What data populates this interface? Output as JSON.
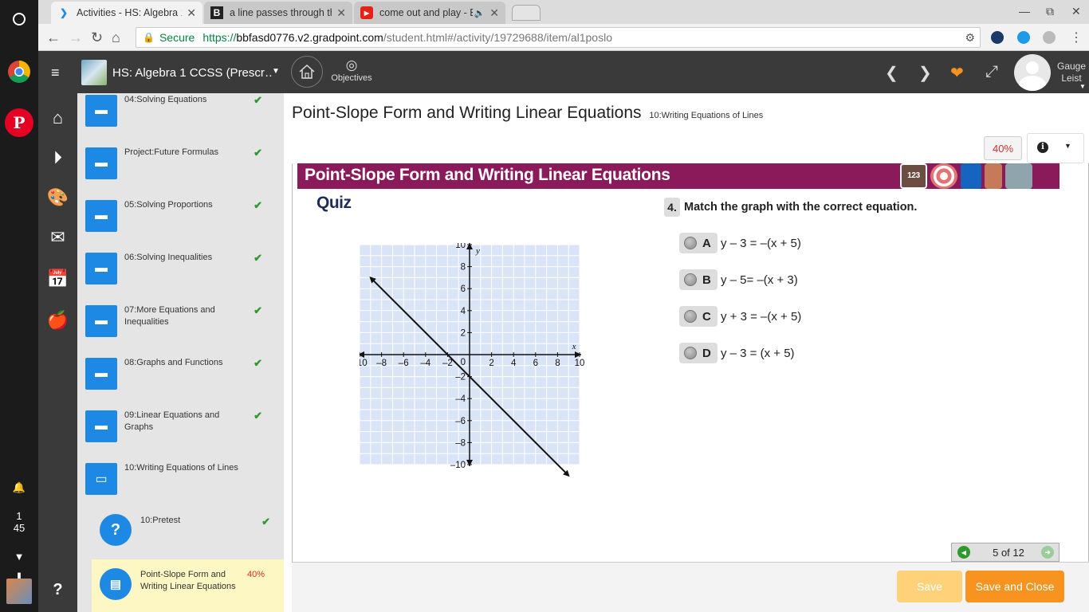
{
  "browser": {
    "tabs": [
      {
        "title": "Activities - HS: Algebra 1",
        "favicon": "gradpoint-icon",
        "active": true
      },
      {
        "title": "a line passes through th",
        "favicon": "b-icon",
        "active": false
      },
      {
        "title": "come out and play - B",
        "favicon": "youtube-icon",
        "active": false
      }
    ],
    "secure_label": "Secure",
    "url_scheme": "https://",
    "url_host": "bbfasd0776.v2.gradpoint.com",
    "url_path": "/student.html#/activity/19729688/item/al1poslo"
  },
  "shelf": {
    "clock_hour": "1",
    "clock_min": "45"
  },
  "appbar": {
    "course_title": "HS: Algebra 1 CCSS (Prescr…",
    "objectives_label": "Objectives",
    "user_first": "Gauge",
    "user_last": "Leist"
  },
  "sidebar": {
    "units": [
      {
        "label": "04:Solving Equations",
        "done": true
      },
      {
        "label": "Project:Future Formulas",
        "done": true
      },
      {
        "label": "05:Solving Proportions",
        "done": true
      },
      {
        "label": "06:Solving Inequalities",
        "done": true
      },
      {
        "label": "07:More Equations and Inequalities",
        "done": true
      },
      {
        "label": "08:Graphs and Functions",
        "done": true
      },
      {
        "label": "09:Linear Equations and Graphs",
        "done": true
      },
      {
        "label": "10:Writing Equations of Lines",
        "done": false
      }
    ],
    "subitems": [
      {
        "label": "10:Pretest",
        "done": true
      },
      {
        "label": "Point-Slope Form and Writing Linear Equations",
        "percent": "40%"
      }
    ],
    "check_mark": "✔"
  },
  "main": {
    "title": "Point-Slope Form and Writing Linear Equations",
    "subtitle": "10:Writing Equations of Lines",
    "progress": "40%",
    "banner_title": "Point-Slope Form and Writing Linear Equations",
    "banner_badge": "123",
    "quiz_label": "Quiz",
    "question_number": "4.",
    "question_text": "Match the graph with the correct equation.",
    "choices": [
      {
        "letter": "A",
        "equation": "y – 3 = –(x + 5)"
      },
      {
        "letter": "B",
        "equation": "y – 5= –(x + 3)"
      },
      {
        "letter": "C",
        "equation": "y + 3 = –(x + 5)"
      },
      {
        "letter": "D",
        "equation": "y – 3 = (x + 5)"
      }
    ],
    "pager_text": "5 of 12",
    "save_label": "Save",
    "save_close_label": "Save and Close"
  },
  "graph": {
    "x_ticks": [
      "–10",
      "–8",
      "–6",
      "–4",
      "–2",
      "2",
      "4",
      "6",
      "8",
      "10"
    ],
    "y_ticks": [
      "10",
      "8",
      "6",
      "4",
      "2",
      "–2",
      "–4",
      "–6",
      "–8",
      "–10"
    ],
    "origin_label": "0",
    "x_axis_label": "x",
    "y_axis_label": "y",
    "range": [
      -10,
      10
    ],
    "line_slope": -1,
    "line_intercept": -2,
    "grid_color": "#d9e4f7"
  },
  "colors": {
    "banner": "#8b1a5a",
    "accent_blue": "#1e88e5",
    "save_close": "#f7931e",
    "save_disabled": "#ffd27a",
    "check_green": "#2e9a2e"
  }
}
